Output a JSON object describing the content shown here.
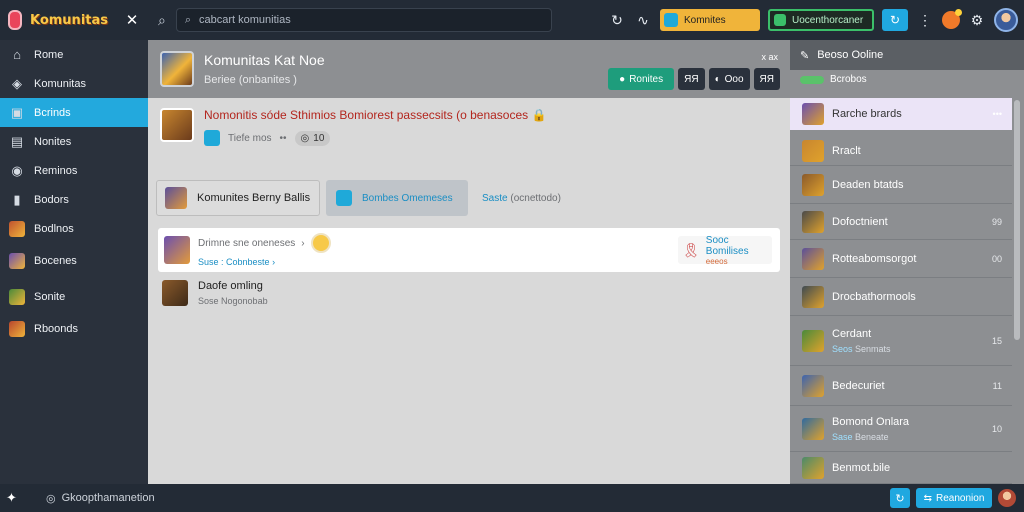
{
  "app": {
    "logo_text": "Komunitas",
    "close_icon": "close-icon"
  },
  "topbar": {
    "search_placeholder": "cabcart komunitias",
    "pill_orange_label": "Komnites",
    "pill_green_label": "Uocenthorcaner"
  },
  "sidebar": {
    "items": [
      {
        "label": "Rome",
        "icon": "home-icon"
      },
      {
        "label": "Komunitas",
        "icon": "community-icon"
      },
      {
        "label": "Bcrinds",
        "icon": "trending-icon"
      },
      {
        "label": "Nonites",
        "icon": "news-icon"
      },
      {
        "label": "Reminos",
        "icon": "compass-icon"
      },
      {
        "label": "Bodors",
        "icon": "bookmark-icon"
      },
      {
        "label": "Bodlnos",
        "icon": "game-thumb"
      },
      {
        "label": "Bocenes",
        "icon": "game-thumb"
      },
      {
        "label": "Sonite",
        "icon": "game-thumb"
      },
      {
        "label": "Rboonds",
        "icon": "game-thumb"
      }
    ]
  },
  "hero": {
    "title": "Komunitas Kat Noe",
    "subtitle": "Beriee (onbanites )",
    "close_label": "x ax",
    "action_primary": "Ronites",
    "action_b": "ЯЯ",
    "action_c": "Ooo",
    "action_d": "ЯЯ"
  },
  "topic": {
    "title": "Nomonitis sóde Sthimios Bomiorest passecsits (o benasoces",
    "meta_label": "Tiefe mos",
    "meta_sep": "••",
    "count": "10"
  },
  "cards": {
    "a_label": "Komunites Berny Ballis",
    "b_label": "Bombes Omemeses",
    "c_label": "Saste",
    "c_sub": "(ocnettodo)"
  },
  "post_white": {
    "title": "Drimne sne oneneses",
    "title_arrow": "›",
    "sub": "Suse : Cobnbeste",
    "sub_arrow": "›",
    "right_title": "Sooc Bomilises",
    "right_sub": "eeeos"
  },
  "post_plain": {
    "title": "Daofe omling",
    "sub_a": "Sose",
    "sub_b": "Nogonobab"
  },
  "rpanel": {
    "head": "Beoso Ooline",
    "tab": "Bcrobos",
    "items": [
      {
        "title": "Rarche brards",
        "meta": "•••",
        "active": true
      },
      {
        "title": "Rraclt"
      },
      {
        "title": "Deaden btatds"
      },
      {
        "title": "Dofoctnient",
        "meta": "99"
      },
      {
        "title": "Rotteabomsorgot",
        "meta": "00"
      },
      {
        "title": "Drocbathormools"
      },
      {
        "title": "Cerdant",
        "sub_a": "Seos",
        "sub_b": "Senmats",
        "meta": "15"
      },
      {
        "title": "Bedecuriet",
        "meta": "11"
      },
      {
        "title": "Bomond Onlara",
        "sub_a": "Sase",
        "sub_b": "Beneate",
        "meta": "10"
      },
      {
        "title": "Benmot.bile"
      }
    ]
  },
  "bottombar": {
    "status": "Gkoopthamanetion",
    "btn_label": "Reanonion"
  },
  "colors": {
    "accent_blue": "#23a9dd",
    "sidebar_bg": "#2a313c",
    "topic_red": "#b3261e",
    "link_blue": "#1a8ec4"
  }
}
